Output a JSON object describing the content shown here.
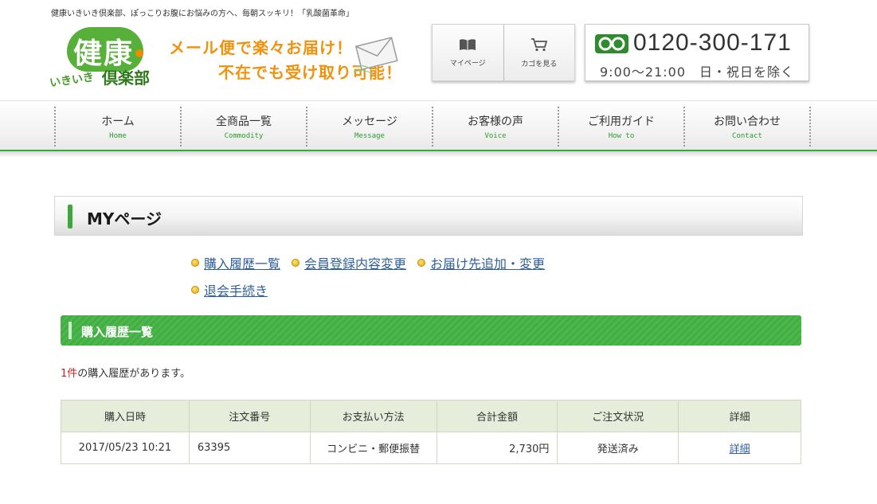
{
  "header": {
    "tagline": "健康いきいき倶楽部、ぽっこりお腹にお悩みの方へ、毎朝スッキリ！「乳酸菌革命」",
    "logo": {
      "main": "健康",
      "sub1": "いきいき",
      "sub2": "倶楽部"
    },
    "promo": {
      "line1": "メール便で楽々お届け！",
      "line2": "不在でも受け取り可能！"
    },
    "buttons": [
      {
        "label": "マイページ",
        "icon": "book-icon"
      },
      {
        "label": "カゴを見る",
        "icon": "cart-icon"
      }
    ],
    "phone": {
      "number": "0120-300-171",
      "hours": "9:00～21:00　日・祝日を除く",
      "icon": "freedial-icon"
    }
  },
  "nav": {
    "items": [
      {
        "jp": "ホーム",
        "en": "Home"
      },
      {
        "jp": "全商品一覧",
        "en": "Commodity"
      },
      {
        "jp": "メッセージ",
        "en": "Message"
      },
      {
        "jp": "お客様の声",
        "en": "Voice"
      },
      {
        "jp": "ご利用ガイド",
        "en": "How to"
      },
      {
        "jp": "お問い合わせ",
        "en": "Contact"
      }
    ]
  },
  "mypage": {
    "title": "MYページ",
    "links": [
      "購入履歴一覧",
      "会員登録内容変更",
      "お届け先追加・変更",
      "退会手続き"
    ]
  },
  "history": {
    "section_title": "購入履歴一覧",
    "count": "1件",
    "count_suffix": "の購入履歴があります。",
    "columns": [
      "購入日時",
      "注文番号",
      "お支払い方法",
      "合計金額",
      "ご注文状況",
      "詳細"
    ],
    "rows": [
      {
        "date": "2017/05/23 10:21",
        "order_no": "63395",
        "payment": "コンビニ・郵便振替",
        "amount": "2,730円",
        "status": "発送済み",
        "detail": "詳細"
      }
    ]
  },
  "colors": {
    "accent_green": "#3aa93a",
    "promo_orange": "#f0920e",
    "link_blue": "#2f5f9a"
  }
}
